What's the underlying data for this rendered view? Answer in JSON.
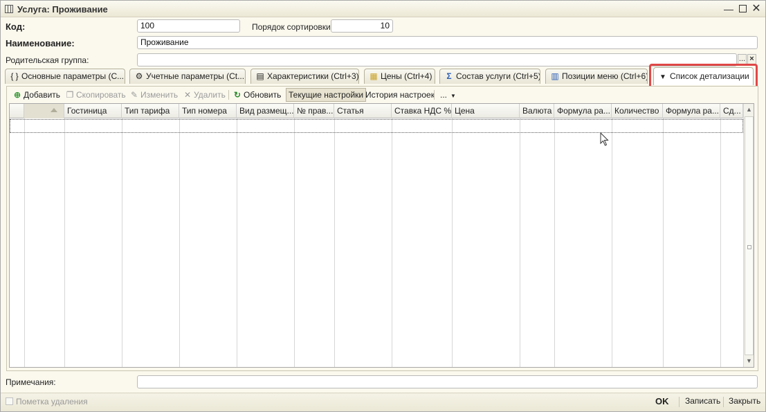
{
  "window": {
    "title": "Услуга: Проживание"
  },
  "form": {
    "code_label": "Код:",
    "code_value": "100",
    "sort_label": "Порядок сортировки:",
    "sort_value": "10",
    "name_label": "Наименование:",
    "name_value": "Проживание",
    "parent_label": "Родительская группа:",
    "parent_value": "",
    "parent_select_label": "...",
    "parent_clear_label": "×"
  },
  "tabs": [
    {
      "label": "Основные параметры (C...",
      "icon": "braces-icon"
    },
    {
      "label": "Учетные параметры (Ct...",
      "icon": "gear-icon"
    },
    {
      "label": "Характеристики (Ctrl+3)",
      "icon": "document-icon"
    },
    {
      "label": "Цены (Ctrl+4)",
      "icon": "price-list-icon"
    },
    {
      "label": "Состав услуги (Ctrl+5)",
      "icon": "sigma-icon"
    },
    {
      "label": "Позиции меню (Ctrl+6)",
      "icon": "menu-positions-icon"
    },
    {
      "label": "Список детализации",
      "icon": "triangle-down-icon",
      "active": true
    }
  ],
  "toolbar": {
    "add": "Добавить",
    "copy": "Скопировать",
    "edit": "Изменить",
    "delete": "Удалить",
    "refresh": "Обновить",
    "current_settings": "Текущие настройки",
    "settings_history": "История настроек",
    "more": "..."
  },
  "grid": {
    "columns": [
      "",
      "Гостиница",
      "Тип тарифа",
      "Тип номера",
      "Вид размещ...",
      "№ прав...",
      "Статья",
      "Ставка НДС %",
      "Цена",
      "Валюта",
      "Формула ра...",
      "Количество",
      "Формула ра...",
      "Сд..."
    ],
    "rows": []
  },
  "notes": {
    "label": "Примечания:",
    "value": ""
  },
  "footer": {
    "deletion_mark": "Пометка удаления",
    "ok": "OK",
    "save": "Записать",
    "close": "Закрыть"
  },
  "colors": {
    "accent_highlight": "#e04848",
    "background": "#fbf9ee"
  }
}
